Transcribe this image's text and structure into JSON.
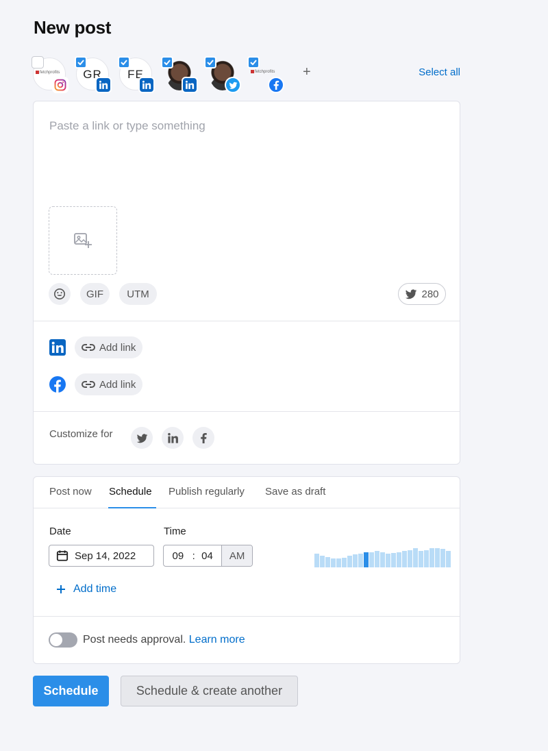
{
  "page": {
    "title": "New post"
  },
  "accounts": {
    "items": [
      {
        "kind": "logo",
        "label": "fetchprofits",
        "network": "instagram-icon",
        "checked": false
      },
      {
        "kind": "initials",
        "label": "GR",
        "network": "linkedin-icon",
        "checked": true
      },
      {
        "kind": "initials",
        "label": "FE",
        "network": "linkedin-icon",
        "checked": true
      },
      {
        "kind": "photo",
        "network": "linkedin-icon",
        "checked": true
      },
      {
        "kind": "photo",
        "network": "twitter-icon",
        "checked": true
      },
      {
        "kind": "logo",
        "label": "fetchprofits",
        "network": "facebook-icon",
        "checked": true
      }
    ],
    "add_label": "+",
    "select_all": "Select all"
  },
  "composer": {
    "placeholder": "Paste a link or type something",
    "tools": {
      "gif": "GIF",
      "utm": "UTM"
    },
    "char_count": "280",
    "links": [
      {
        "network": "linkedin-icon",
        "label": "Add link"
      },
      {
        "network": "facebook-icon",
        "label": "Add link"
      }
    ],
    "customize_label": "Customize for"
  },
  "schedule": {
    "tabs": [
      "Post now",
      "Schedule",
      "Publish regularly",
      "Save as draft"
    ],
    "active_tab": "Schedule",
    "date_label": "Date",
    "date_value": "Sep 14, 2022",
    "time_label": "Time",
    "hour": "09",
    "minute": "04",
    "ampm": "AM",
    "activity_levels": [
      0.72,
      0.62,
      0.55,
      0.45,
      0.45,
      0.5,
      0.6,
      0.68,
      0.7,
      0.78,
      0.78,
      0.85,
      0.8,
      0.72,
      0.75,
      0.78,
      0.85,
      0.9,
      1.0,
      0.85,
      0.9,
      1.0,
      1.0,
      0.95,
      0.85
    ],
    "selected_index": 9,
    "add_time": "Add time",
    "approval_text": "Post needs approval.",
    "learn_more": "Learn more"
  },
  "actions": {
    "primary": "Schedule",
    "secondary": "Schedule & create another"
  },
  "colors": {
    "accent": "#2b8ee8",
    "link": "#006dca",
    "linkedin": "#0a66c2",
    "twitter": "#1d9bf0",
    "facebook": "#1877f2"
  }
}
